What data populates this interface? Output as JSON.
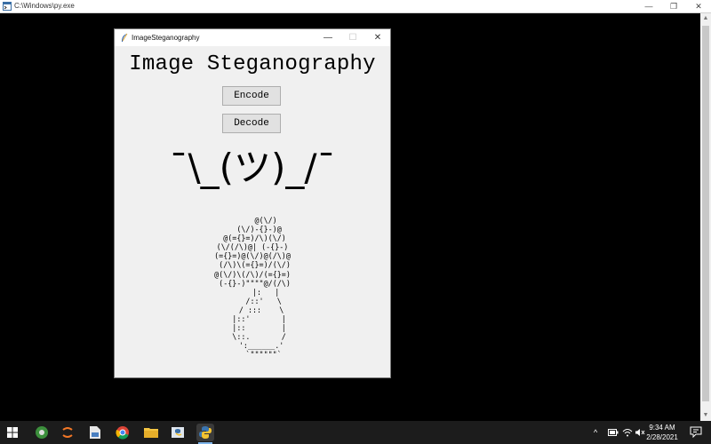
{
  "console": {
    "title": "C:\\Windows\\py.exe",
    "controls": {
      "minimize": "—",
      "restore": "❐",
      "close": "✕"
    }
  },
  "app": {
    "title": "ImageSteganography",
    "controls": {
      "minimize": "—",
      "maximize": "☐",
      "close": "✕"
    },
    "heading": "Image Steganography",
    "encode_label": "Encode",
    "decode_label": "Decode",
    "shrug": "¯\\_(ツ)_/¯",
    "flower_art": "      @(\\/)\n   (\\/)-{}-)@\n @(={}=)/\\)(\\/)\n(\\/(/\\)@| (-{}-)\n(={}=)@(\\/)@(/\\)@\n (/\\)\\(={}=)/(\\/)\n@(\\/)\\(/\\)/(={}=)\n (-{}-)\"\"\"\"@/(/\\)\n      |:   |\n     /::'   \\\n    / :::    \\\n   |::'       |\n   |::        |\n   \\::.       /\n    ':______.'\n     `\"\"\"\"\"\"`"
  },
  "taskbar": {
    "icons": [
      "start-icon",
      "vscode-icon",
      "jupyter-icon",
      "file-icon",
      "chrome-icon",
      "explorer-icon",
      "idle-icon",
      "python-icon"
    ],
    "clock_time": "9:34 AM",
    "clock_date": "2/28/2021"
  },
  "colors": {
    "desktop": "#000000",
    "window_bg": "#f0f0f0",
    "taskbar": "#1c1c1c",
    "accent": "#7eb4ea"
  }
}
